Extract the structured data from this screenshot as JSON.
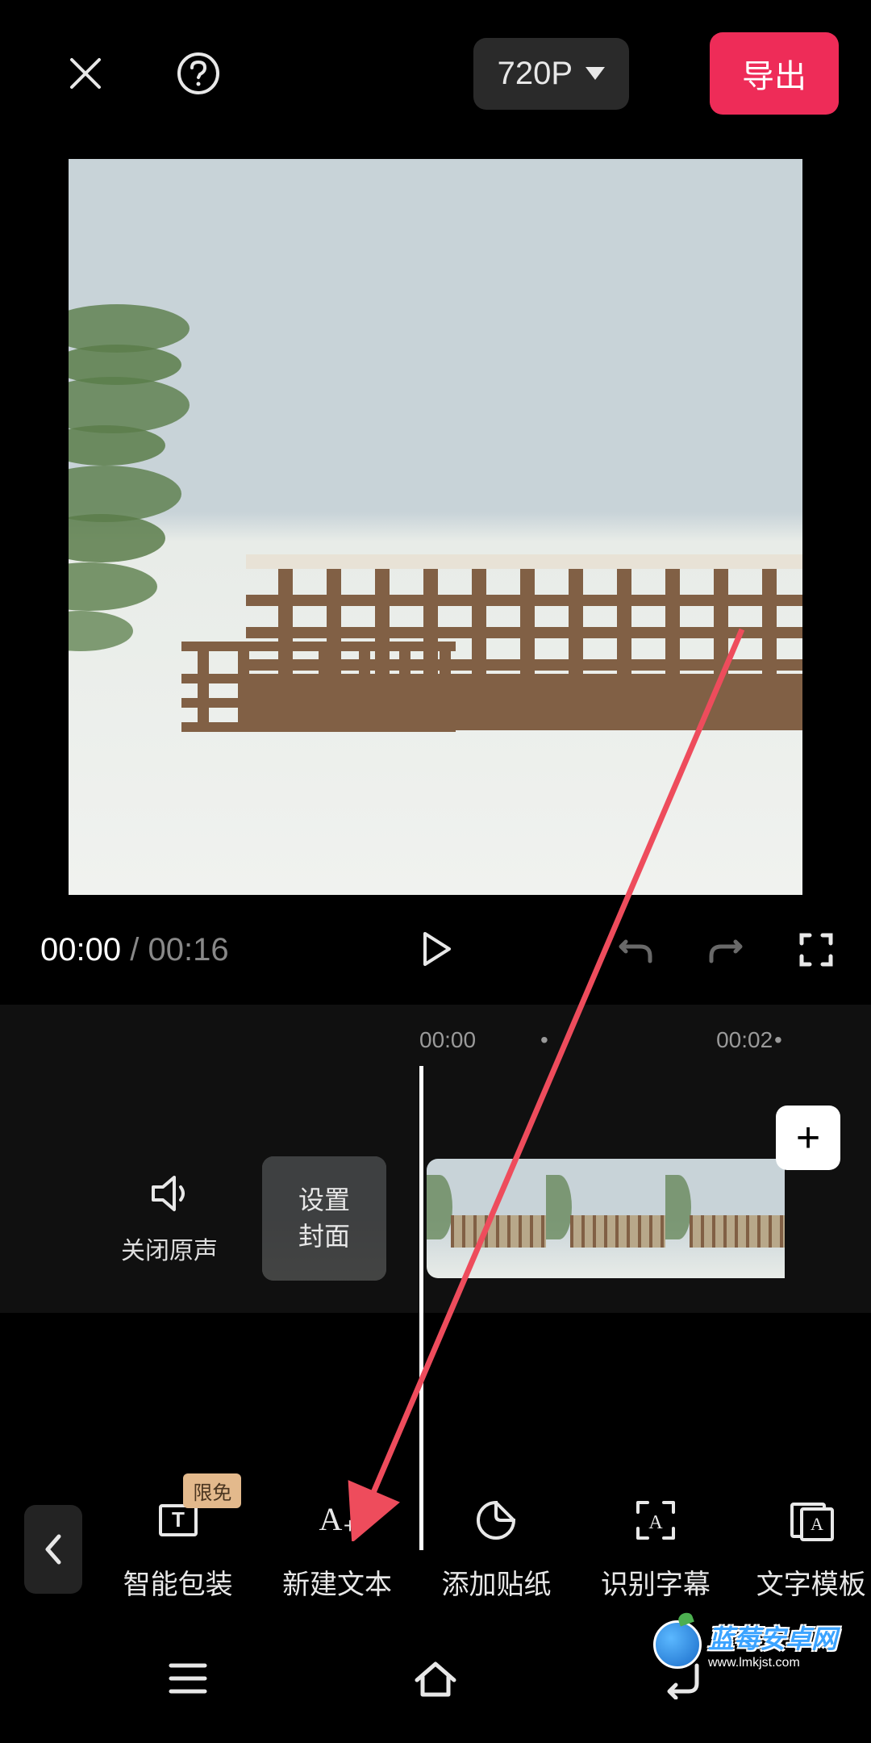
{
  "header": {
    "resolution": "720P",
    "export_label": "导出"
  },
  "playback": {
    "current_time": "00:00",
    "total_time": "00:16"
  },
  "timeline": {
    "marker_1": "00:00",
    "marker_2": "00:02",
    "mute_label": "关闭原声",
    "cover_label": "设置\n封面"
  },
  "toolbar": {
    "badge_limited": "限免",
    "smart_package": "智能包装",
    "new_text": "新建文本",
    "add_sticker": "添加贴纸",
    "recognize_subtitle": "识别字幕",
    "text_template": "文字模板"
  },
  "watermark": {
    "title": "蓝莓安卓网",
    "url": "www.lmkjst.com"
  }
}
